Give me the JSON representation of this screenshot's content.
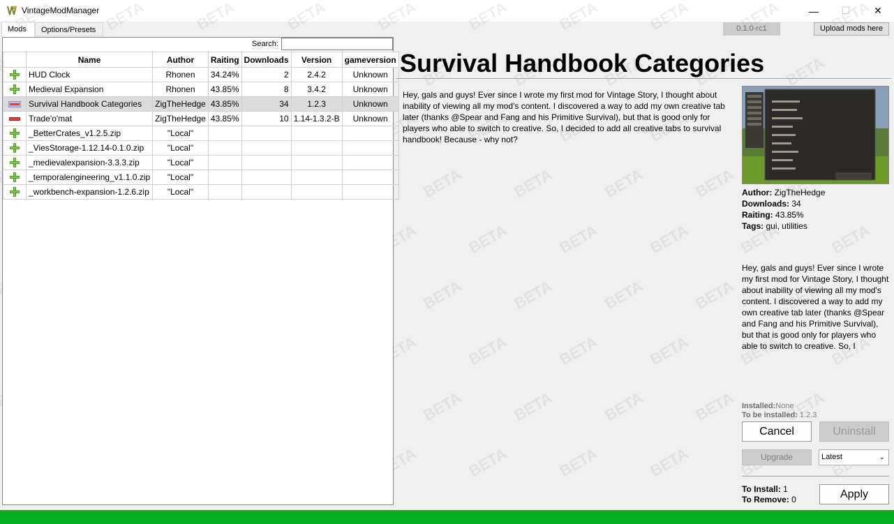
{
  "window": {
    "title": "VintageModManager",
    "controls": {
      "minimize": "—",
      "maximize": "☐",
      "close": "✕"
    }
  },
  "tabs": [
    {
      "label": "Mods",
      "active": true
    },
    {
      "label": "Options/Presets",
      "active": false
    }
  ],
  "toolbar": {
    "version": "0.1.0-rc1",
    "upload_label": "Upload mods here"
  },
  "search": {
    "label": "Search:",
    "value": ""
  },
  "table": {
    "columns": [
      "Name",
      "Author",
      "Raiting",
      "Downloads",
      "Version",
      "gameversion"
    ],
    "rows": [
      {
        "icon": "add-icon",
        "name": "HUD Clock",
        "author": "Rhonen",
        "raiting": "34.24%",
        "downloads": "2",
        "version": "2.4.2",
        "gameversion": "Unknown"
      },
      {
        "icon": "add-icon",
        "name": "Medieval Expansion",
        "author": "Rhonen",
        "raiting": "43.85%",
        "downloads": "8",
        "version": "3.4.2",
        "gameversion": "Unknown"
      },
      {
        "icon": "pending-remove-icon",
        "name": "Survival Handbook Categories",
        "author": "ZigTheHedge",
        "raiting": "43.85%",
        "downloads": "34",
        "version": "1.2.3",
        "gameversion": "Unknown",
        "selected": true
      },
      {
        "icon": "remove-icon",
        "name": "Trade'o'mat",
        "author": "ZigTheHedge",
        "raiting": "43.85%",
        "downloads": "10",
        "version": "1.14-1.3.2-B",
        "gameversion": "Unknown"
      },
      {
        "icon": "add-icon",
        "name": "_BetterCrates_v1.2.5.zip",
        "author": "\"Local\"",
        "raiting": "",
        "downloads": "",
        "version": "",
        "gameversion": ""
      },
      {
        "icon": "add-icon",
        "name": "_ViesStorage-1.12.14-0.1.0.zip",
        "author": "\"Local\"",
        "raiting": "",
        "downloads": "",
        "version": "",
        "gameversion": ""
      },
      {
        "icon": "add-icon",
        "name": "_medievalexpansion-3.3.3.zip",
        "author": "\"Local\"",
        "raiting": "",
        "downloads": "",
        "version": "",
        "gameversion": ""
      },
      {
        "icon": "add-icon",
        "name": "_temporalengineering_v1.1.0.zip",
        "author": "\"Local\"",
        "raiting": "",
        "downloads": "",
        "version": "",
        "gameversion": ""
      },
      {
        "icon": "add-icon",
        "name": "_workbench-expansion-1.2.6.zip",
        "author": "\"Local\"",
        "raiting": "",
        "downloads": "",
        "version": "",
        "gameversion": ""
      }
    ]
  },
  "details": {
    "title": "Survival Handbook Categories",
    "description": "Hey, gals and guys! Ever since I wrote my first mod for Vintage Story, I thought about inability of viewing all my mod's content. I discovered a way to add my own creative tab later (thanks @Spear and Fang and his Primitive Survival), but that is good only for players who able to switch to creative. So, I decided to add all creative tabs to survival handbook! Because - why not?",
    "author_label": "Author:",
    "author": "ZigTheHedge",
    "downloads_label": "Downloads:",
    "downloads": "34",
    "raiting_label": "Raiting:",
    "raiting": "43.85%",
    "tags_label": "Tags:",
    "tags": "gui, utilities",
    "description_side": "Hey, gals and guys! Ever since I wrote my first mod for Vintage Story, I thought about inability of viewing all my mod's content. I discovered a way to add my own creative tab later (thanks @Spear and Fang and his Primitive Survival), but that is good only for players who able to switch to creative. So, I",
    "installed_label": "Installed:",
    "installed": "None",
    "to_be_installed_label": "To be installed:",
    "to_be_installed": "1.2.3"
  },
  "actions": {
    "cancel": "Cancel",
    "uninstall": "Uninstall",
    "upgrade": "Upgrade",
    "version_option": "Latest",
    "to_install_label": "To Install:",
    "to_install": "1",
    "to_remove_label": "To Remove:",
    "to_remove": "0",
    "apply": "Apply"
  },
  "progress": {
    "fraction": 1.0,
    "color": "#06b025"
  },
  "watermark": "BETA",
  "colors": {
    "accent_green": "#06b025",
    "add_icon": "#7fcf45",
    "remove_icon": "#d94040"
  }
}
